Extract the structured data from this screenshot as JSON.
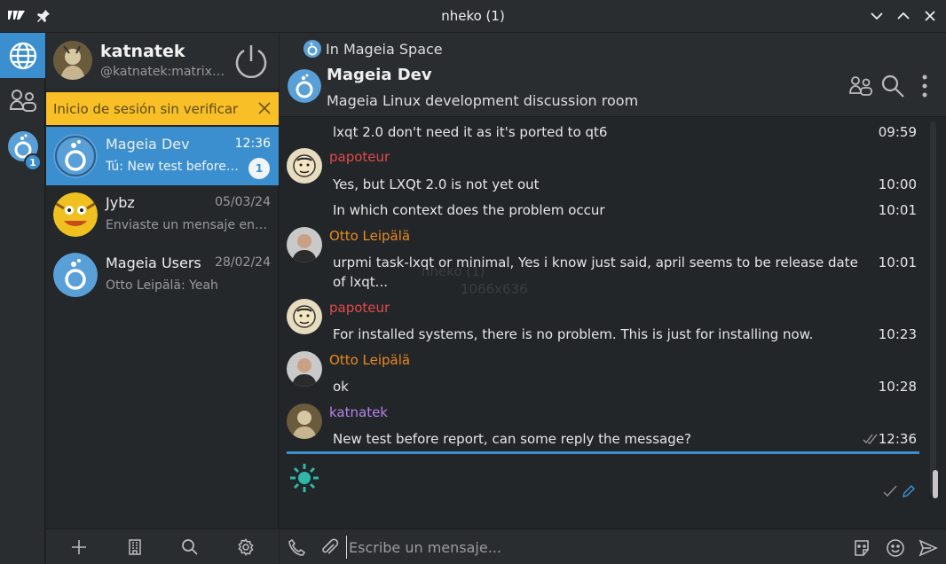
{
  "window": {
    "title": "nheko (1)",
    "app_icon": "nheko-logo-icon",
    "watermark_title": "nheko (1)",
    "watermark_size": "1066x636"
  },
  "rail": {
    "items": [
      {
        "icon": "globe-icon"
      },
      {
        "icon": "people-icon"
      },
      {
        "icon": "mageia-space-icon",
        "badge": "1"
      }
    ]
  },
  "user": {
    "name": "katnatek",
    "id": "@katnatek:matrix...."
  },
  "verify_banner": {
    "text": "Inicio de sesión sin verificar"
  },
  "rooms": [
    {
      "name": "Mageia Dev",
      "time": "12:36",
      "last": "Tú: New test before re...",
      "badge": "1",
      "active": true
    },
    {
      "name": "Jybz",
      "time": "05/03/24",
      "last": "Enviaste un mensaje encri..."
    },
    {
      "name": "Mageia Users",
      "time": "28/02/24",
      "last": "Otto Leipälä: Yeah"
    }
  ],
  "chat": {
    "space": "In Mageia Space",
    "title": "Mageia Dev",
    "topic": "Mageia Linux development discussion room",
    "messages": [
      {
        "body": "lxqt 2.0 don't need it as it's ported to qt6",
        "time": "09:59"
      },
      {
        "sender": "papoteur",
        "body": "Yes, but LXQt 2.0 is not yet out",
        "time": "10:00"
      },
      {
        "body": "In which context does the problem occur",
        "time": "10:01"
      },
      {
        "sender": "Otto Leipälä",
        "body_line1": "urpmi task-lxqt or minimal, Yes i know just said, april seems to be release date",
        "body_line2": "of lxqt...",
        "time": "10:01"
      },
      {
        "sender": "papoteur",
        "body": "For installed systems, there is no problem. This is just for installing now.",
        "time": "10:23"
      },
      {
        "sender": "Otto Leipälä",
        "body": "ok",
        "time": "10:28"
      },
      {
        "sender": "katnatek",
        "body": "New test before report, can some reply the message?",
        "time": "12:36"
      }
    ]
  },
  "input": {
    "placeholder": "Escribe un mensaje..."
  },
  "colors": {
    "accent": "#3b8fcf",
    "banner": "#f8bf26",
    "papoteur": "#e04a4a",
    "otto": "#e98a1e",
    "katnatek": "#b482e8"
  }
}
